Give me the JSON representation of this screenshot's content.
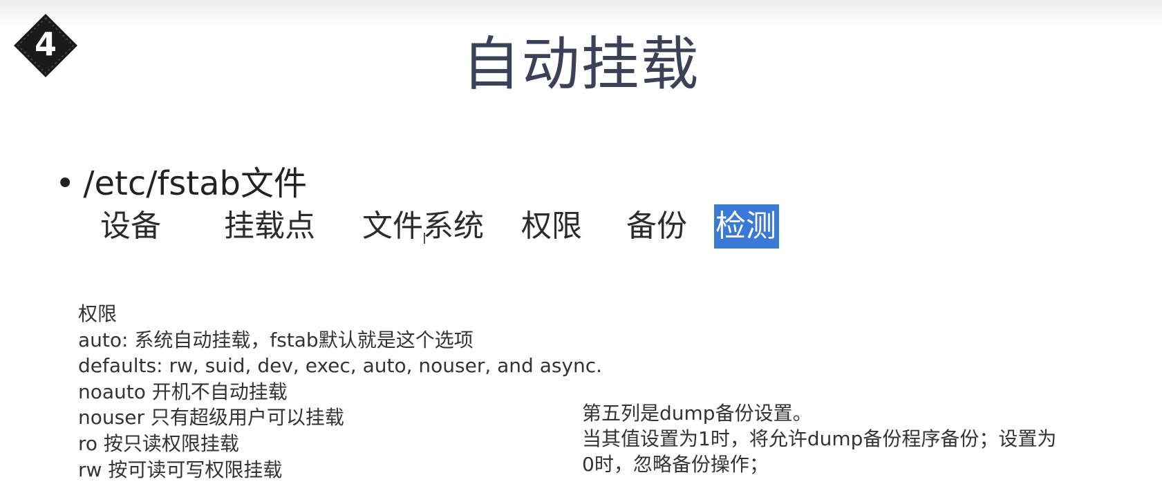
{
  "slide": {
    "number": "4",
    "title": "自动挂载"
  },
  "bullet": {
    "dot": "•",
    "text": "/etc/fstab文件"
  },
  "columns": [
    {
      "label": "设备"
    },
    {
      "label": "挂载点"
    },
    {
      "label": "文件系统"
    },
    {
      "label": "权限"
    },
    {
      "label": "备份"
    },
    {
      "label": "检测",
      "selected": true
    }
  ],
  "options_notes": {
    "lines": [
      "权限",
      "auto: 系统自动挂载，fstab默认就是这个选项",
      "defaults: rw, suid, dev, exec, auto, nouser, and async.",
      "noauto 开机不自动挂载",
      "nouser 只有超级用户可以挂载",
      "ro 按只读权限挂载",
      "rw 按可读可写权限挂载"
    ]
  },
  "dump_notes": {
    "lines": [
      "第五列是dump备份设置。",
      "当其值设置为1时，将允许dump备份程序备份；设置为",
      "0时，忽略备份操作；"
    ]
  },
  "colors": {
    "title": "#3b4257",
    "highlight": "#3b79d6",
    "badge": "#1a1a1a"
  },
  "icons": {
    "badge": "diamond-badge-icon"
  }
}
